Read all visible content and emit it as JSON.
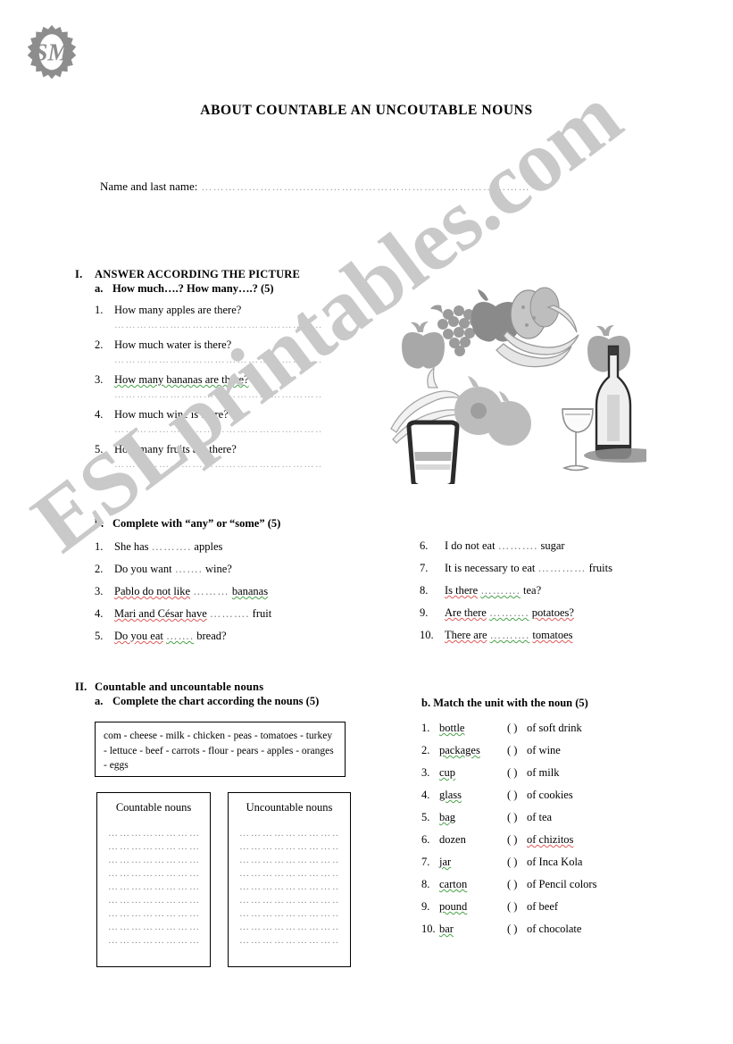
{
  "document": {
    "title": "ABOUT COUNTABLE  AN UNCOUTABLE NOUNS",
    "logo_text": "SM",
    "watermark": "ESLprintables.com"
  },
  "name_field": {
    "label": "Name and last name:",
    "dots": "…………………….....….……………………………………………"
  },
  "section1": {
    "numeral": "I.",
    "heading": "ANSWER ACCORDING THE PICTURE",
    "part_a": {
      "letter": "a.",
      "heading": "How much….?  How many….? (5)",
      "questions": [
        {
          "n": "1.",
          "text": "How many apples are there?"
        },
        {
          "n": "2.",
          "text": "How much water is there?"
        },
        {
          "n": "3.",
          "text": "How many  bananas are there?"
        },
        {
          "n": "4.",
          "text": "How much wine is there?"
        },
        {
          "n": "5.",
          "text": "How many fruits are there?"
        }
      ],
      "answer_dots": "…………………………………………………………………"
    },
    "part_b": {
      "letter": "b.",
      "heading": "Complete with “any” or “some” (5)",
      "left_items": [
        {
          "n": "1.",
          "pre": "She has",
          "blank": "……….",
          "post": "apples"
        },
        {
          "n": "2.",
          "pre": "Do you want",
          "blank": "…….",
          "post": "wine?"
        },
        {
          "n": "3.",
          "pre": "Pablo do not like",
          "blank": "………",
          "post": "bananas"
        },
        {
          "n": "4.",
          "pre": "Mari and César have",
          "blank": "……….",
          "post": "fruit"
        },
        {
          "n": "5.",
          "pre": "Do you eat",
          "blank": "…….",
          "post": "bread?"
        }
      ],
      "right_items": [
        {
          "n": "6.",
          "pre": "I do not eat",
          "blank": "……….",
          "post": "sugar"
        },
        {
          "n": "7.",
          "pre": "It is necessary to eat",
          "blank": "…………",
          "post": "fruits"
        },
        {
          "n": "8.",
          "pre": "Is there",
          "blank": "……….",
          "post": "tea?"
        },
        {
          "n": "9.",
          "pre": "Are there",
          "blank": "……….",
          "post": "potatoes?"
        },
        {
          "n": "10.",
          "pre": "There are",
          "blank": "……….",
          "post": "tomatoes"
        }
      ]
    }
  },
  "section2": {
    "numeral": "II.",
    "heading": "Countable and  uncountable nouns",
    "part_a": {
      "letter": "a.",
      "heading": "Complete the chart according the nouns (5)",
      "word_bank": "com - cheese  - milk - chicken - peas - tomatoes - turkey - lettuce - beef - carrots - flour - pears - apples - oranges - eggs",
      "countable_title": "Countable nouns",
      "uncountable_title": "Uncountable nouns",
      "blank_line": "…………………………",
      "line_count": 9
    },
    "part_b": {
      "heading": "b. Match the unit with the noun (5)",
      "items": [
        {
          "n": "1.",
          "unit": "bottle",
          "paren": "(   )",
          "noun": "of soft drink"
        },
        {
          "n": "2.",
          "unit": "packages",
          "paren": "(   )",
          "noun": "of wine"
        },
        {
          "n": "3.",
          "unit": "cup",
          "paren": "(   )",
          "noun": "of milk"
        },
        {
          "n": "4.",
          "unit": "glass",
          "paren": "(   )",
          "noun": "of cookies"
        },
        {
          "n": "5.",
          "unit": "bag",
          "paren": "(   )",
          "noun": "of tea"
        },
        {
          "n": "6.",
          "unit": "dozen",
          "paren": "(   )",
          "noun": "of chizitos"
        },
        {
          "n": "7.",
          "unit": "jar",
          "paren": "(   )",
          "noun": "of Inca Kola"
        },
        {
          "n": "8.",
          "unit": "carton",
          "paren": "(   )",
          "noun": "of Pencil colors"
        },
        {
          "n": "9.",
          "unit": "pound",
          "paren": "(   )",
          "noun": "of beef"
        },
        {
          "n": "10.",
          "unit": "bar",
          "paren": "(   )",
          "noun": "of chocolate"
        }
      ]
    }
  },
  "illustration": {
    "description": "still life of fruit, a glass of water, a wine bottle and wine glass",
    "items": [
      "apple",
      "grapes",
      "bananas",
      "tomatoes",
      "glass-of-water",
      "wine-bottle",
      "wine-glass"
    ]
  },
  "colors": {
    "text": "#000000",
    "dots": "#9a9a9a",
    "watermark": "#c9c9c9",
    "illustration_gray": "#a9a9a9"
  }
}
